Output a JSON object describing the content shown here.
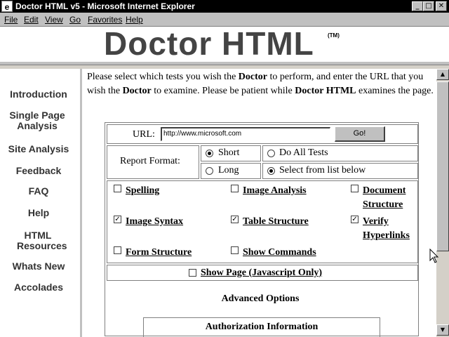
{
  "window": {
    "title": "Doctor HTML v5 - Microsoft Internet Explorer",
    "buttons": {
      "minimize": "_",
      "maximize": "□",
      "close": "✕"
    }
  },
  "menu": [
    "File",
    "Edit",
    "View",
    "Go",
    "Favorites",
    "Help"
  ],
  "banner": {
    "logo": "Doctor HTML",
    "tm": "(TM)"
  },
  "nav": [
    "Introduction",
    "Single Page Analysis",
    "Site Analysis",
    "Feedback",
    "FAQ",
    "Help",
    "HTML Resources",
    "Whats New",
    "Accolades"
  ],
  "intro": {
    "p1": "Please select which tests you wish the ",
    "b1": "Doctor",
    "p2": " to perform, and enter the URL that you wish the ",
    "b2": "Doctor",
    "p3": " to examine. Please be patient while ",
    "b3": "Doctor HTML",
    "p4": " examines the page."
  },
  "form": {
    "url_label": "URL:",
    "url_value": "http://www.microsoft.com",
    "go_label": "Go!",
    "report_format_label": "Report Format:",
    "format_options": [
      {
        "label": "Short",
        "selected": true
      },
      {
        "label": "Long",
        "selected": false
      }
    ],
    "scope_options": [
      {
        "label": "Do All Tests",
        "selected": false
      },
      {
        "label": "Select from list below",
        "selected": true
      }
    ],
    "tests": [
      {
        "label": "Spelling",
        "checked": false
      },
      {
        "label": "Image Analysis",
        "checked": false
      },
      {
        "label": "Document Structure",
        "checked": false
      },
      {
        "label": "Image Syntax",
        "checked": true
      },
      {
        "label": "Table Structure",
        "checked": true
      },
      {
        "label": "Verify Hyperlinks",
        "checked": true
      },
      {
        "label": "Form Structure",
        "checked": false
      },
      {
        "label": "Show Commands",
        "checked": false
      }
    ],
    "show_page": {
      "label": "Show Page (Javascript Only)",
      "checked": false
    }
  },
  "advanced_options": "Advanced Options",
  "authorization": "Authorization Information"
}
